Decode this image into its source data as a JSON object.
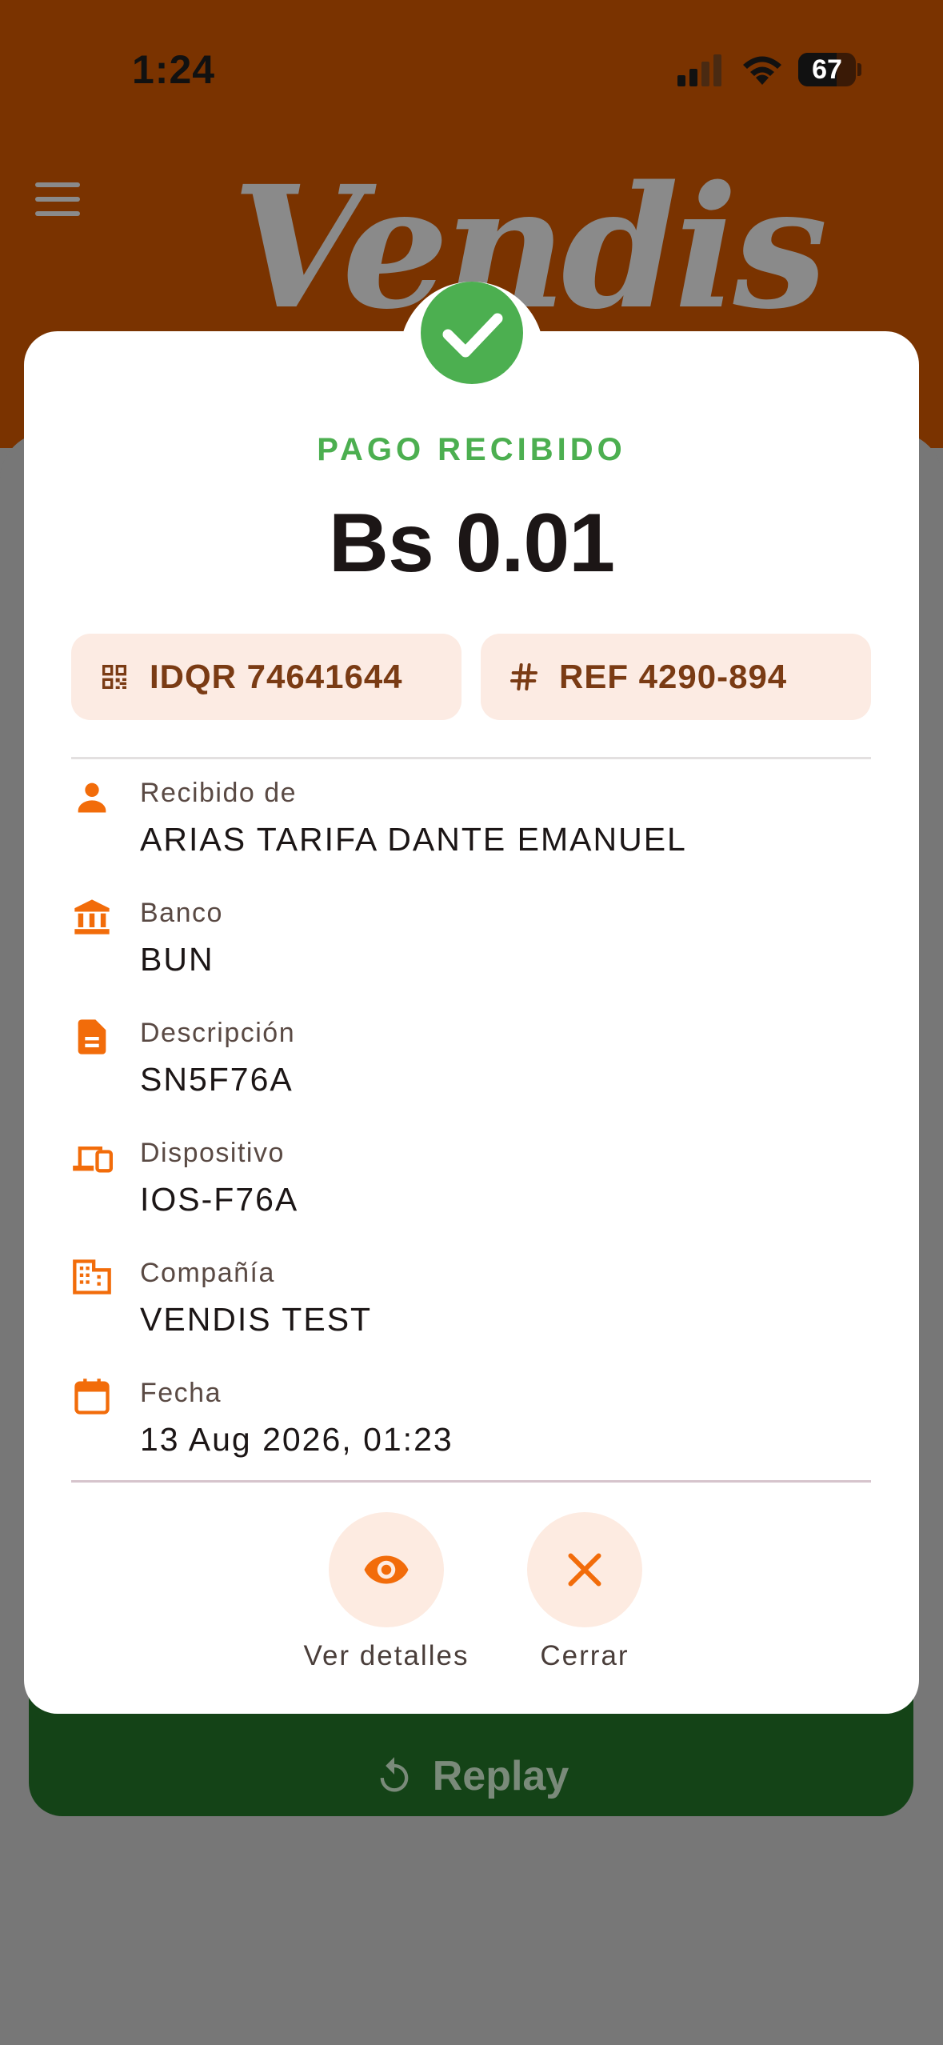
{
  "status_bar": {
    "time": "1:24",
    "battery": "67",
    "battery_level": 0.67
  },
  "header": {
    "logo": "Vendis"
  },
  "background": {
    "replay_label": "Replay"
  },
  "dialog": {
    "status_title": "PAGO RECIBIDO",
    "amount": "Bs 0.01",
    "chips": {
      "idqr": "IDQR 74641644",
      "ref": "REF 4290-894"
    },
    "details": [
      {
        "label": "Recibido de",
        "value": "ARIAS TARIFA DANTE EMANUEL",
        "icon": "person-icon"
      },
      {
        "label": "Banco",
        "value": "BUN",
        "icon": "bank-icon"
      },
      {
        "label": "Descripción",
        "value": "SN5F76A",
        "icon": "document-icon"
      },
      {
        "label": "Dispositivo",
        "value": "IOS-F76A",
        "icon": "devices-icon"
      },
      {
        "label": "Compañía",
        "value": "VENDIS TEST",
        "icon": "building-icon"
      },
      {
        "label": "Fecha",
        "value": "13 Aug 2026, 01:23",
        "icon": "calendar-icon"
      }
    ],
    "actions": {
      "details_label": "Ver detalles",
      "close_label": "Cerrar"
    }
  },
  "colors": {
    "header_bg": "#7a3300",
    "accent_orange": "#f26c0a",
    "success_green": "#4caf50",
    "chip_bg": "#fcebe3",
    "chip_text": "#7a3b14",
    "replay_bg": "#144317",
    "overlay_gray": "#777777"
  }
}
